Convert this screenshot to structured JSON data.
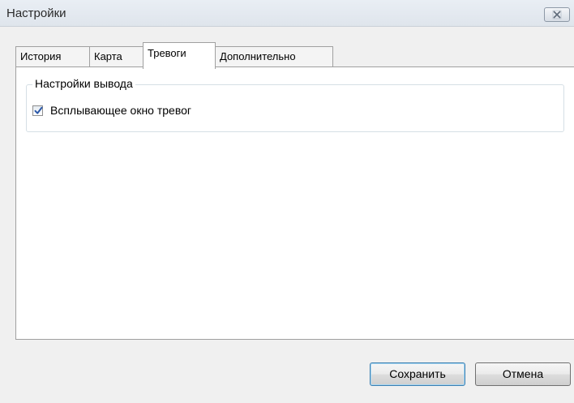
{
  "window": {
    "title": "Настройки"
  },
  "tabs": [
    {
      "label": "История",
      "active": false
    },
    {
      "label": "Карта",
      "active": false
    },
    {
      "label": "Тревоги",
      "active": true
    },
    {
      "label": "Дополнительно",
      "active": false
    }
  ],
  "panel": {
    "group_title": "Настройки вывода",
    "popup_checkbox": {
      "label": "Всплывающее окно тревог",
      "checked": true
    }
  },
  "buttons": {
    "save_label": "Сохранить",
    "cancel_label": "Отмена"
  },
  "colors": {
    "title_bar": "#dfe5ec",
    "dialog_bg": "#f0f0f0",
    "panel_bg": "#ffffff",
    "check_mark": "#2a57a8",
    "default_button_border": "#3c7fb1"
  },
  "icons": {
    "close": "close-icon",
    "check": "checkmark-icon"
  }
}
